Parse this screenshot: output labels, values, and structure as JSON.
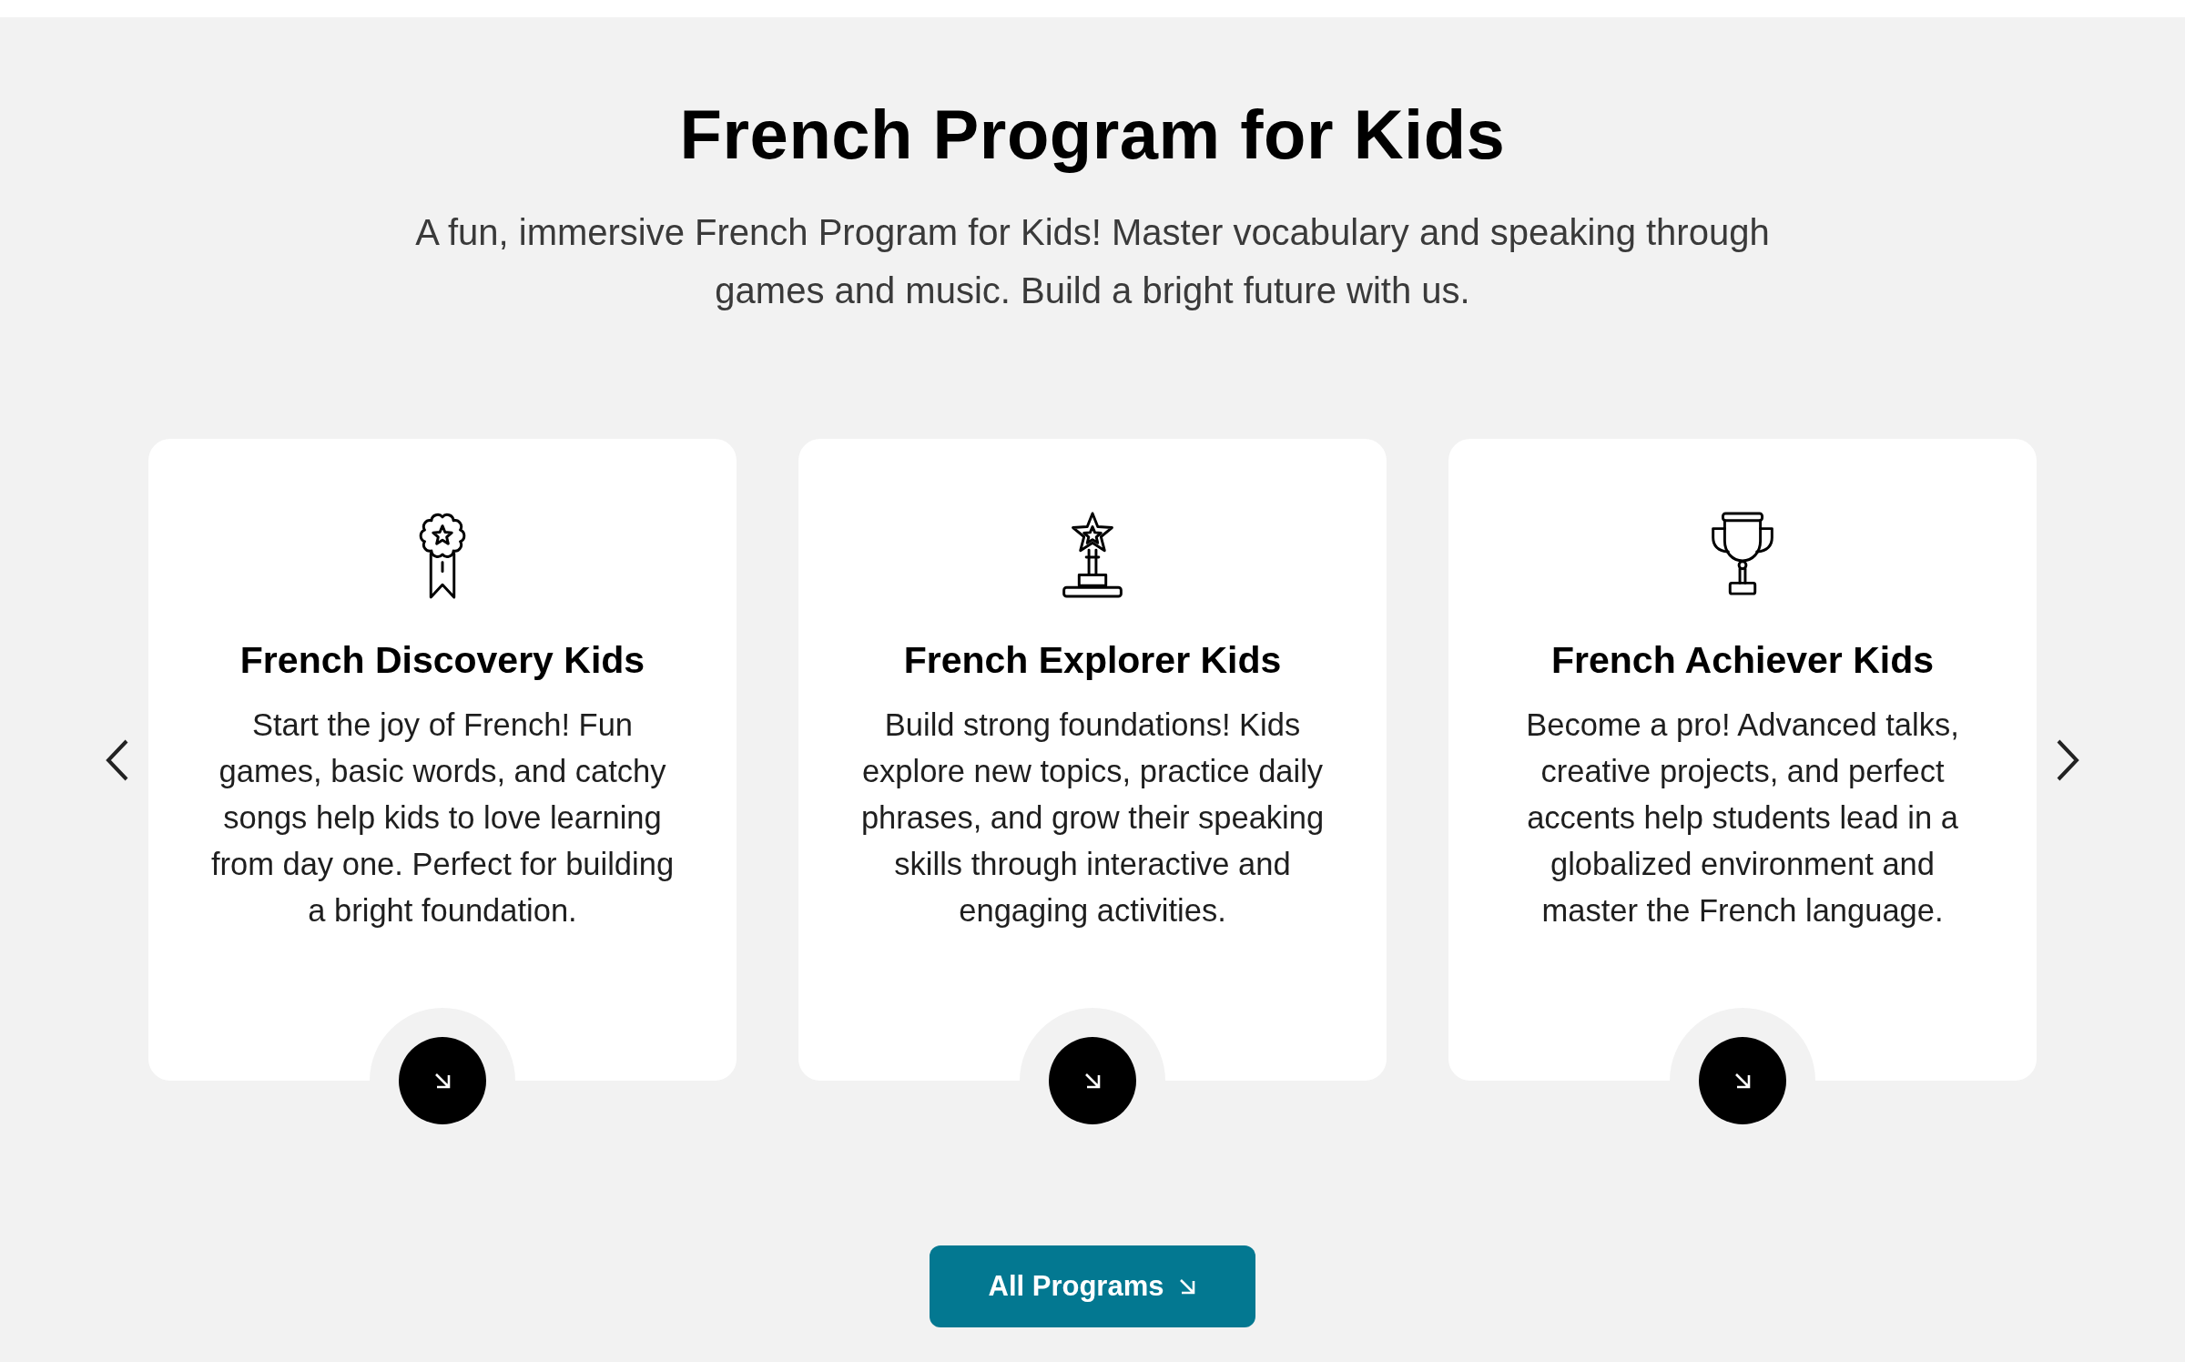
{
  "section": {
    "title": "French Program for Kids",
    "subtitle": "A fun, immersive French Program for Kids! Master vocabulary and speaking through games and music. Build a bright future with us."
  },
  "carousel": {
    "programs": [
      {
        "title": "French Discovery Kids",
        "description": "Start the joy of French! Fun games, basic words, and catchy songs help kids to love learning from day one. Perfect for building a bright foundation."
      },
      {
        "title": "French Explorer Kids",
        "description": "Build strong foundations! Kids explore new topics, practice daily phrases, and grow their speaking skills through interactive and engaging activities."
      },
      {
        "title": "French Achiever Kids",
        "description": "Become a pro! Advanced talks, creative projects, and perfect accents help students lead in a globalized environment and master the French language."
      }
    ]
  },
  "cta_button": {
    "label": "All Programs"
  }
}
